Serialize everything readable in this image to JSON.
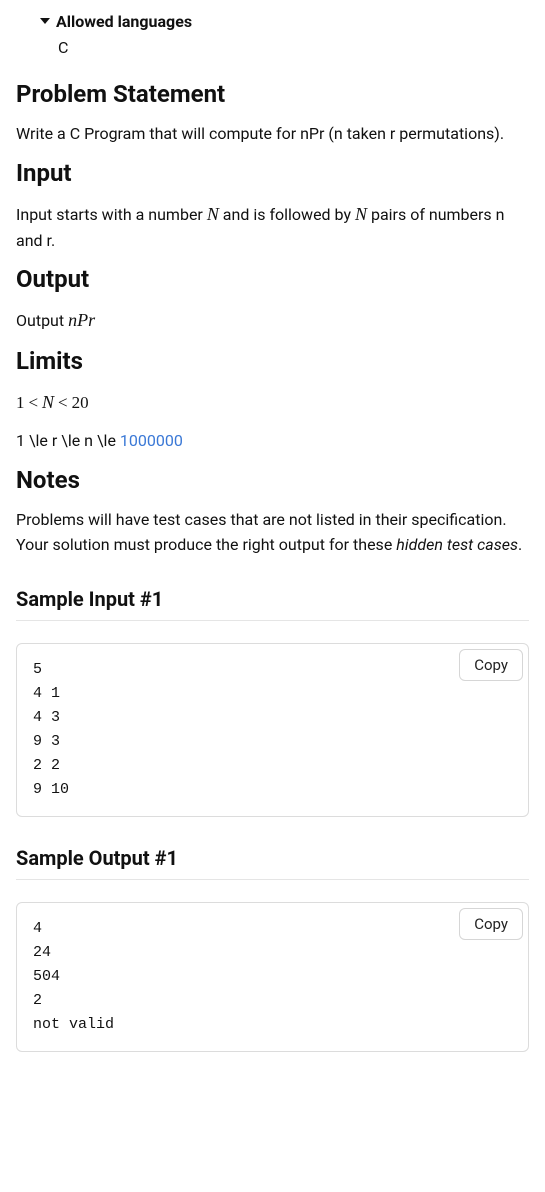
{
  "allowed": {
    "title": "Allowed languages",
    "body": "C"
  },
  "headings": {
    "problem": "Problem Statement",
    "input": "Input",
    "output": "Output",
    "limits": "Limits",
    "notes": "Notes",
    "sample_input_1": "Sample Input #1",
    "sample_output_1": "Sample Output #1"
  },
  "problem_text": "Write a C Program that will compute for nPr (n taken r permutations).",
  "input_text_pre": "Input starts with a number ",
  "input_text_mid1": " and is followed by ",
  "input_text_post": " pairs of numbers n and r.",
  "output_text_pre": "Output ",
  "output_nPr_n": "n",
  "output_nPr_P": "P",
  "output_nPr_r": "r",
  "limits_line1_pre": "1",
  "limits_line1_lt1": "<",
  "limits_line1_N": "N",
  "limits_line1_lt2": "<",
  "limits_line1_post": "20",
  "limits_line2_pre": "1 \\le r \\le n \\le ",
  "limits_line2_link": "1000000",
  "notes_text_pre": "Problems will have test cases that are not listed in their specification. Your solution must produce the right output for these ",
  "notes_text_italic": "hidden test cases",
  "notes_text_post": ".",
  "math_N": "N",
  "copy_label": "Copy",
  "sample_input_1_code": "5\n4 1\n4 3\n9 3\n2 2\n9 10",
  "sample_output_1_code": "4\n24\n504\n2\nnot valid"
}
